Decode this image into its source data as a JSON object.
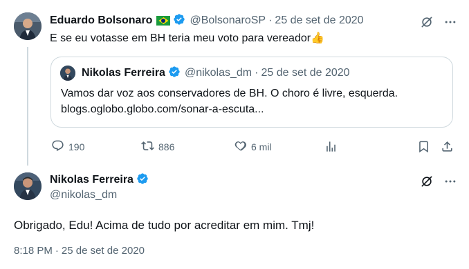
{
  "tweet": {
    "author_name": "Eduardo Bolsonaro",
    "author_flag": "🇧🇷",
    "author_handle": "@BolsonaroSP",
    "separator": "·",
    "date": "25 de set de 2020",
    "text": "E se eu votasse em BH teria meu voto para vereador",
    "text_emoji": "👍",
    "quote": {
      "author_name": "Nikolas Ferreira",
      "author_handle": "@nikolas_dm",
      "separator": "·",
      "date": "25 de set de 2020",
      "text_line1": "Vamos dar voz aos conservadores de BH. O choro é livre, esquerda.",
      "text_line2": "blogs.oglobo.globo.com/sonar-a-escuta..."
    },
    "actions": {
      "reply_count": "190",
      "retweet_count": "886",
      "like_count": "6 mil"
    }
  },
  "reply": {
    "author_name": "Nikolas Ferreira",
    "author_handle": "@nikolas_dm",
    "text": "Obrigado, Edu! Acima de tudo por acreditar em mim. Tmj!",
    "time": "8:18 PM",
    "separator": "·",
    "date": "25 de set de 2020"
  },
  "colors": {
    "verified": "#1d9bf0",
    "muted": "#536471",
    "border": "#cfd9de"
  }
}
